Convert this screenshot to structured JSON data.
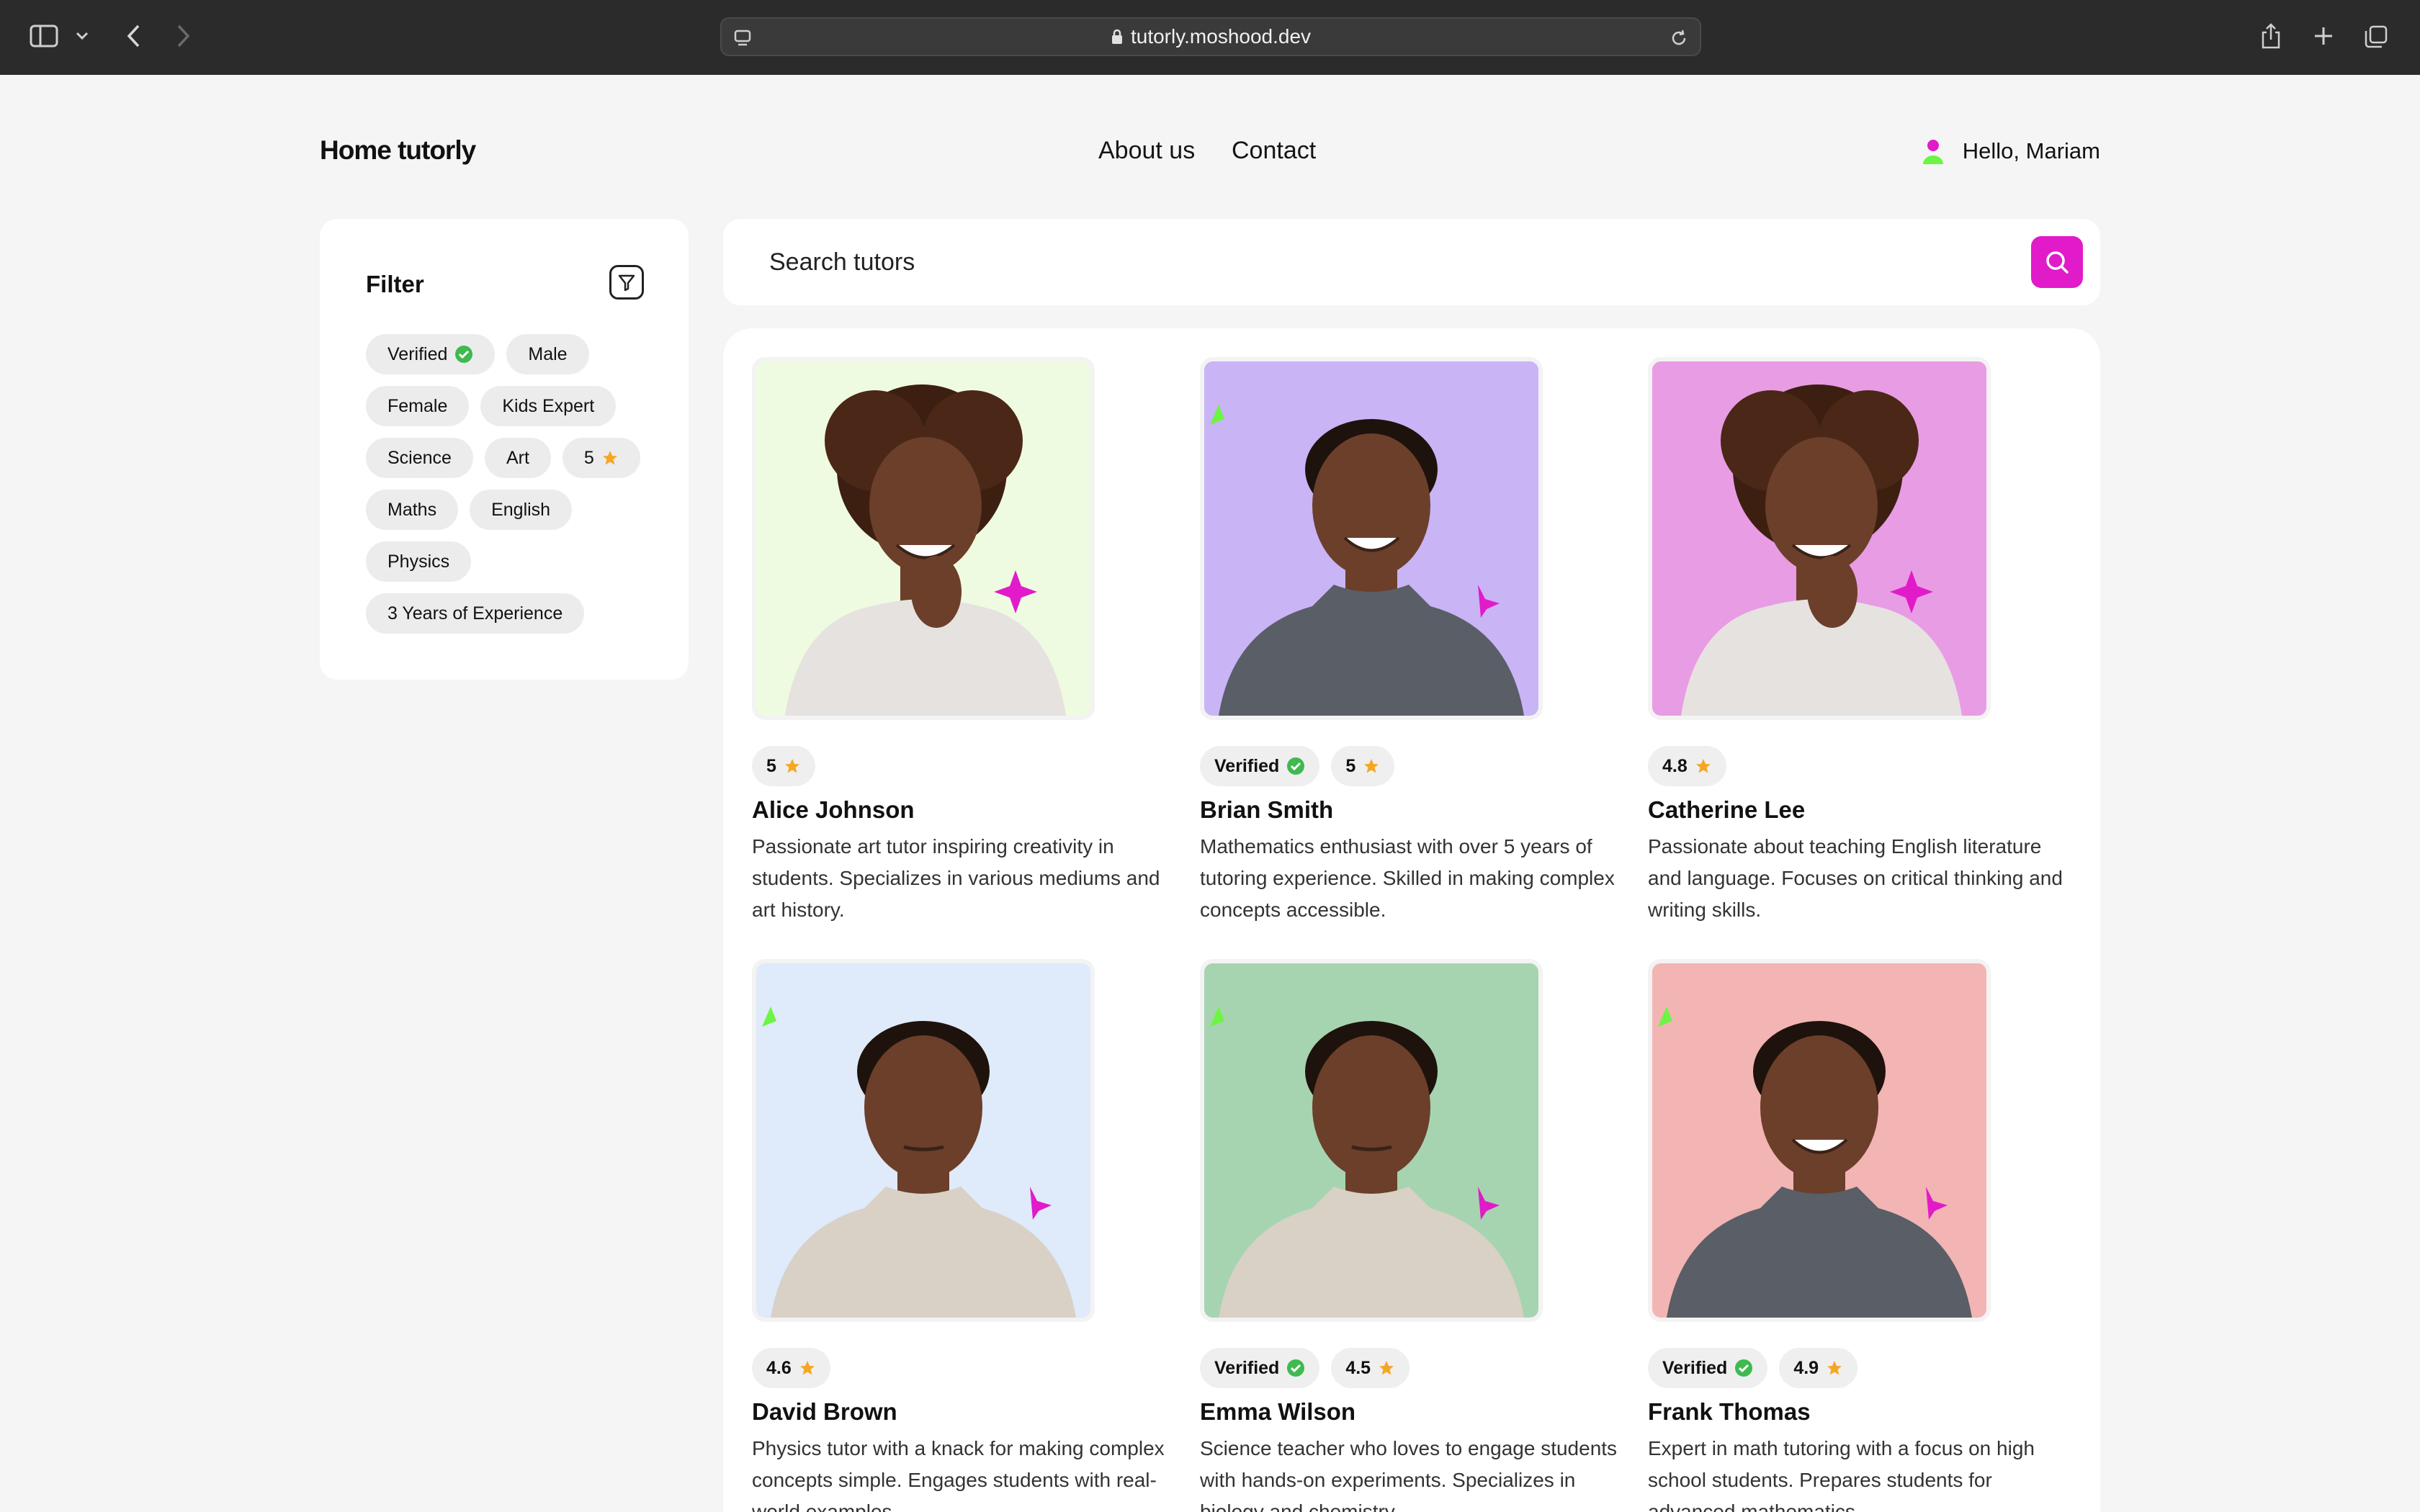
{
  "browser": {
    "url": "tutorly.moshood.dev"
  },
  "header": {
    "logo": "Home tutorly",
    "nav": [
      "About us",
      "Contact"
    ],
    "greeting": "Hello, Mariam"
  },
  "filter": {
    "title": "Filter",
    "chips": [
      {
        "label": "Verified",
        "icon": "check-circle-icon"
      },
      {
        "label": "Male"
      },
      {
        "label": "Female"
      },
      {
        "label": "Kids Expert"
      },
      {
        "label": "Science"
      },
      {
        "label": "Art"
      },
      {
        "label": "5",
        "icon": "star-icon"
      },
      {
        "label": "Maths"
      },
      {
        "label": "English"
      },
      {
        "label": "Physics"
      },
      {
        "label": "3 Years of Experience"
      }
    ]
  },
  "search": {
    "placeholder": "Search tutors"
  },
  "colors": {
    "accent": "#e11bc9",
    "verified": "#3fb950",
    "star": "#f5a623",
    "sparkle_green": "#6cf542"
  },
  "tutors": [
    {
      "name": "Alice Johnson",
      "verified": false,
      "rating": "5",
      "bg": "#eefbe0",
      "gender": "female",
      "description": "Passionate art tutor inspiring creativity in students. Specializes in various mediums and art history."
    },
    {
      "name": "Brian Smith",
      "verified": true,
      "rating": "5",
      "bg": "#c9b4f5",
      "gender": "male-smile",
      "description": "Mathematics enthusiast with over 5 years of tutoring experience. Skilled in making complex concepts accessible."
    },
    {
      "name": "Catherine Lee",
      "verified": false,
      "rating": "4.8",
      "bg": "#e89ce4",
      "gender": "female",
      "description": "Passionate about teaching English literature and language. Focuses on critical thinking and writing skills."
    },
    {
      "name": "David Brown",
      "verified": false,
      "rating": "4.6",
      "bg": "#dfeafb",
      "gender": "male",
      "description": "Physics tutor with a knack for making complex concepts simple. Engages students with real-world examples."
    },
    {
      "name": "Emma Wilson",
      "verified": true,
      "rating": "4.5",
      "bg": "#a6d4b0",
      "gender": "male",
      "description": "Science teacher who loves to engage students with hands-on experiments. Specializes in biology and chemistry."
    },
    {
      "name": "Frank Thomas",
      "verified": true,
      "rating": "4.9",
      "bg": "#f3b4b4",
      "gender": "male-smile",
      "description": "Expert in math tutoring with a focus on high school students. Prepares students for advanced mathematics."
    }
  ],
  "labels": {
    "verified": "Verified"
  }
}
